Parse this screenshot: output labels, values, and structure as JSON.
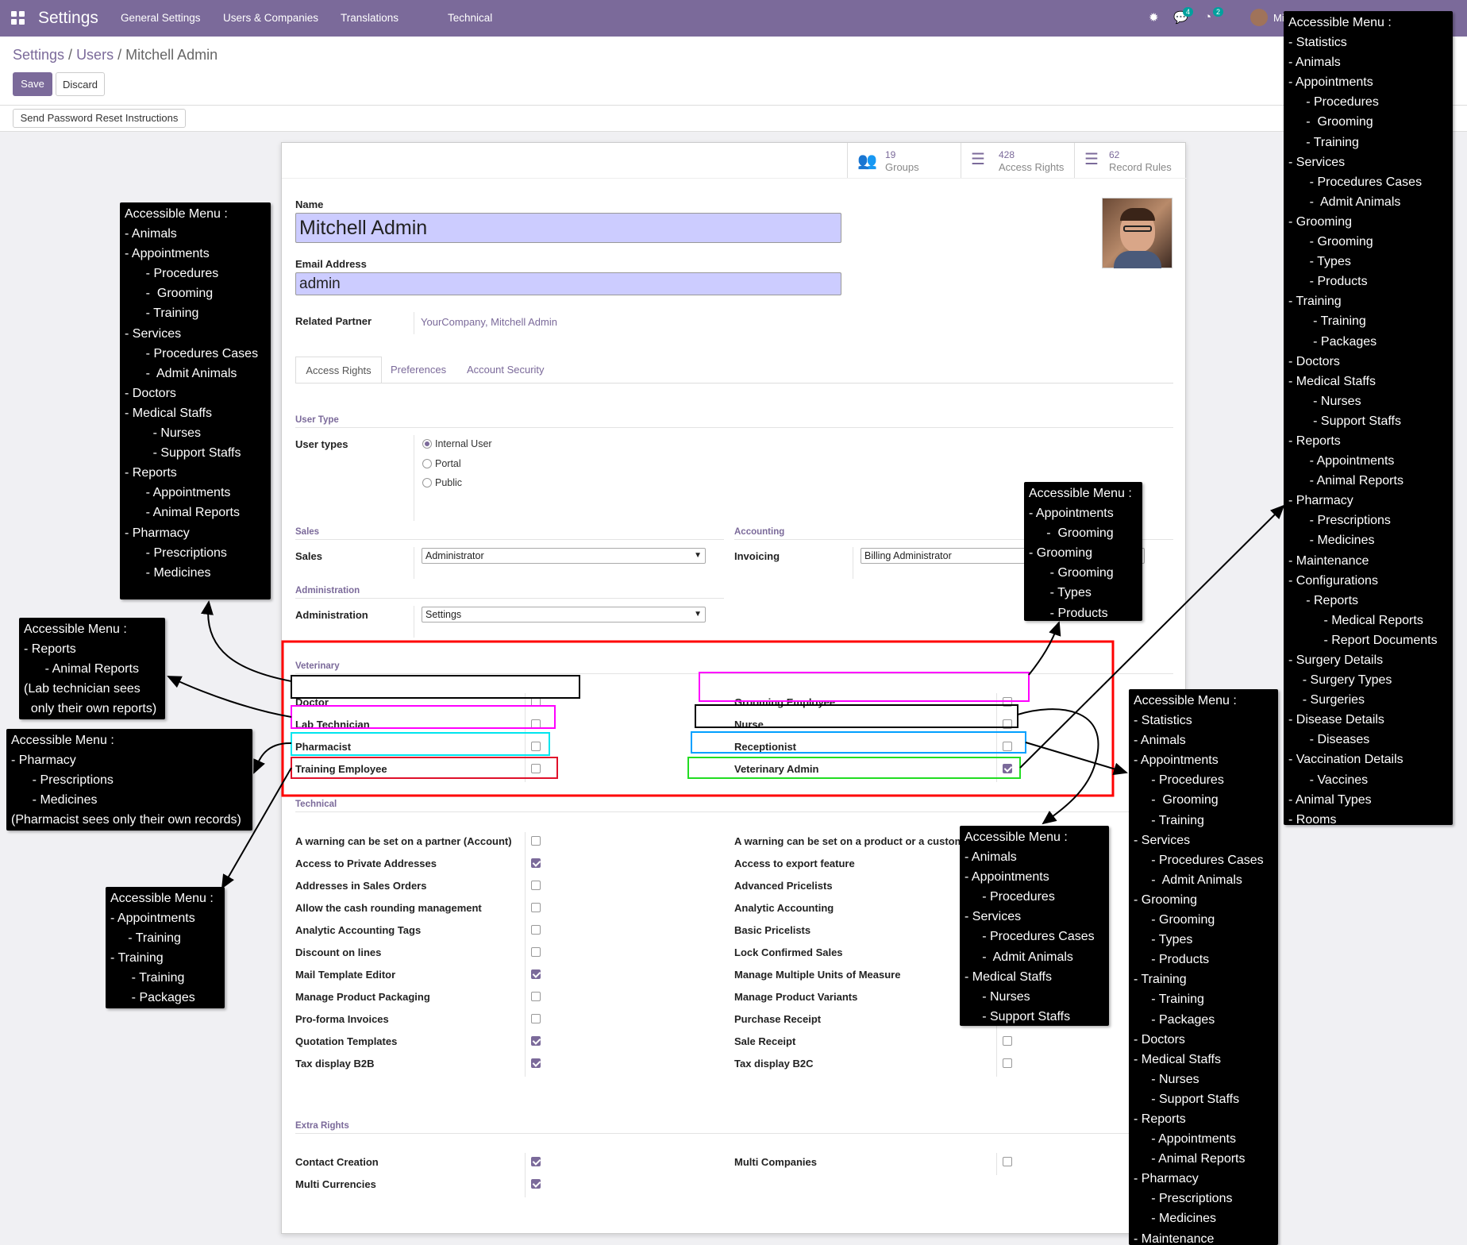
{
  "navbar": {
    "app_title": "Settings",
    "menu": [
      "General Settings",
      "Users & Companies",
      "Translations",
      "Technical"
    ],
    "bug_icon": "bug-icon",
    "messages_badge": "4",
    "activity_badge": "2",
    "user_short": "Mi"
  },
  "breadcrumb": {
    "part1": "Settings",
    "part2": "Users",
    "current": "Mitchell Admin"
  },
  "buttons": {
    "save": "Save",
    "discard": "Discard",
    "reset_password": "Send Password Reset Instructions"
  },
  "stats": [
    {
      "num": "19",
      "label": "Groups",
      "icon": "users-icon"
    },
    {
      "num": "428",
      "label": "Access Rights",
      "icon": "list-icon"
    },
    {
      "num": "62",
      "label": "Record Rules",
      "icon": "list-icon"
    }
  ],
  "form": {
    "name_label": "Name",
    "name_value": "Mitchell Admin",
    "email_label": "Email Address",
    "email_value": "admin",
    "partner_label": "Related Partner",
    "partner_value": "YourCompany, Mitchell Admin"
  },
  "tabs": [
    "Access Rights",
    "Preferences",
    "Account Security"
  ],
  "user_type": {
    "section": "User Type",
    "label": "User types",
    "options": [
      "Internal User",
      "Portal",
      "Public"
    ],
    "selected": "Internal User"
  },
  "sales": {
    "section": "Sales",
    "label": "Sales",
    "value": "Administrator"
  },
  "accounting": {
    "section": "Accounting",
    "label": "Invoicing",
    "value": "Billing Administrator"
  },
  "administration": {
    "section": "Administration",
    "label": "Administration",
    "value": "Settings"
  },
  "veterinary": {
    "section": "Veterinary",
    "left": [
      {
        "label": "Doctor",
        "checked": false
      },
      {
        "label": "Lab Technician",
        "checked": false
      },
      {
        "label": "Pharmacist",
        "checked": false
      },
      {
        "label": "Training Employee",
        "checked": false
      }
    ],
    "right": [
      {
        "label": "Grooming Employee",
        "checked": false
      },
      {
        "label": "Nurse",
        "checked": false
      },
      {
        "label": "Receptionist",
        "checked": false
      },
      {
        "label": "Veterinary Admin",
        "checked": true
      }
    ]
  },
  "technical": {
    "section": "Technical",
    "left": [
      {
        "label": "A warning can be set on a partner (Account)",
        "checked": false
      },
      {
        "label": "Access to Private Addresses",
        "checked": true
      },
      {
        "label": "Addresses in Sales Orders",
        "checked": false
      },
      {
        "label": "Allow the cash rounding management",
        "checked": false
      },
      {
        "label": "Analytic Accounting Tags",
        "checked": false
      },
      {
        "label": "Discount on lines",
        "checked": false
      },
      {
        "label": "Mail Template Editor",
        "checked": true
      },
      {
        "label": "Manage Product Packaging",
        "checked": false
      },
      {
        "label": "Pro-forma Invoices",
        "checked": false
      },
      {
        "label": "Quotation Templates",
        "checked": true
      },
      {
        "label": "Tax display B2B",
        "checked": true
      }
    ],
    "right": [
      {
        "label": "A warning can be set on a product or a customer (Sale)",
        "checked": false
      },
      {
        "label": "Access to export feature",
        "checked": false
      },
      {
        "label": "Advanced Pricelists",
        "checked": false
      },
      {
        "label": "Analytic Accounting",
        "checked": false
      },
      {
        "label": "Basic Pricelists",
        "checked": false
      },
      {
        "label": "Lock Confirmed Sales",
        "checked": false
      },
      {
        "label": "Manage Multiple Units of Measure",
        "checked": false
      },
      {
        "label": "Manage Product Variants",
        "checked": false
      },
      {
        "label": "Purchase Receipt",
        "checked": false
      },
      {
        "label": "Sale Receipt",
        "checked": false
      },
      {
        "label": "Tax display B2C",
        "checked": false
      }
    ]
  },
  "extra_rights": {
    "section": "Extra Rights",
    "left": [
      {
        "label": "Contact Creation",
        "checked": true
      },
      {
        "label": "Multi Currencies",
        "checked": true
      }
    ],
    "right": [
      {
        "label": "Multi Companies",
        "checked": false
      }
    ]
  },
  "annotations": {
    "doctor": [
      "Accessible Menu :",
      "- Animals",
      "- Appointments",
      "      - Procedures",
      "      -  Grooming",
      "      - Training",
      "- Services",
      "      - Procedures Cases",
      "      -  Admit Animals",
      "- Doctors",
      "- Medical Staffs",
      "        - Nurses",
      "        - Support Staffs",
      "- Reports",
      "      - Appointments",
      "      - Animal Reports",
      "- Pharmacy",
      "      - Prescriptions",
      "      - Medicines"
    ],
    "lab": [
      "Accessible Menu :",
      "- Reports",
      "      - Animal Reports",
      "(Lab technician sees",
      "  only their own reports)"
    ],
    "pharmacist": [
      "Accessible Menu :",
      "- Pharmacy",
      "      - Prescriptions",
      "      - Medicines",
      "(Pharmacist sees only their own records)"
    ],
    "training": [
      "Accessible Menu :",
      "- Appointments",
      "     - Training",
      "- Training",
      "      - Training",
      "      - Packages"
    ],
    "grooming": [
      "Accessible Menu :",
      "- Appointments",
      "     -  Grooming",
      "- Grooming",
      "      - Grooming",
      "      - Types",
      "      - Products"
    ],
    "nurse": [
      "Accessible Menu :",
      "- Animals",
      "- Appointments",
      "     - Procedures",
      "- Services",
      "     - Procedures Cases",
      "     -  Admit Animals",
      "- Medical Staffs",
      "     - Nurses",
      "     - Support Staffs"
    ],
    "receptionist": [
      "Accessible Menu :",
      "- Statistics",
      "- Animals",
      "- Appointments",
      "     - Procedures",
      "     -  Grooming",
      "     - Training",
      "- Services",
      "     - Procedures Cases",
      "     -  Admit Animals",
      "- Grooming",
      "     - Grooming",
      "     - Types",
      "     - Products",
      "- Training",
      "     - Training",
      "     - Packages",
      "- Doctors",
      "- Medical Staffs",
      "     - Nurses",
      "     - Support Staffs",
      "- Reports",
      "     - Appointments",
      "     - Animal Reports",
      "- Pharmacy",
      "     - Prescriptions",
      "     - Medicines",
      "- Maintenance"
    ],
    "admin": [
      "Accessible Menu :",
      "- Statistics",
      "- Animals",
      "- Appointments",
      "     - Procedures",
      "     -  Grooming",
      "     - Training",
      "- Services",
      "      - Procedures Cases",
      "      -  Admit Animals",
      "- Grooming",
      "      - Grooming",
      "      - Types",
      "      - Products",
      "- Training",
      "       - Training",
      "       - Packages",
      "- Doctors",
      "- Medical Staffs",
      "       - Nurses",
      "       - Support Staffs",
      "- Reports",
      "      - Appointments",
      "      - Animal Reports",
      "- Pharmacy",
      "      - Prescriptions",
      "      - Medicines",
      "- Maintenance",
      "- Configurations",
      "     - Reports",
      "          - Medical Reports",
      "          - Report Documents",
      "- Surgery Details",
      "    - Surgery Types",
      "    - Surgeries",
      "- Disease Details",
      "      - Diseases",
      "- Vaccination Details",
      "      - Vaccines",
      "- Animal Types",
      "- Rooms"
    ]
  },
  "colors": {
    "brand": "#7b6a9a",
    "highlight_veterinary": "#ff0000",
    "hl_doctor": "#000000",
    "hl_lab": "#ff00ff",
    "hl_pharmacist": "#00e5ee",
    "hl_training": "#e0102a",
    "hl_grooming": "#ff00ff",
    "hl_nurse": "#000000",
    "hl_receptionist": "#00a0ff",
    "hl_admin": "#22dd22"
  }
}
